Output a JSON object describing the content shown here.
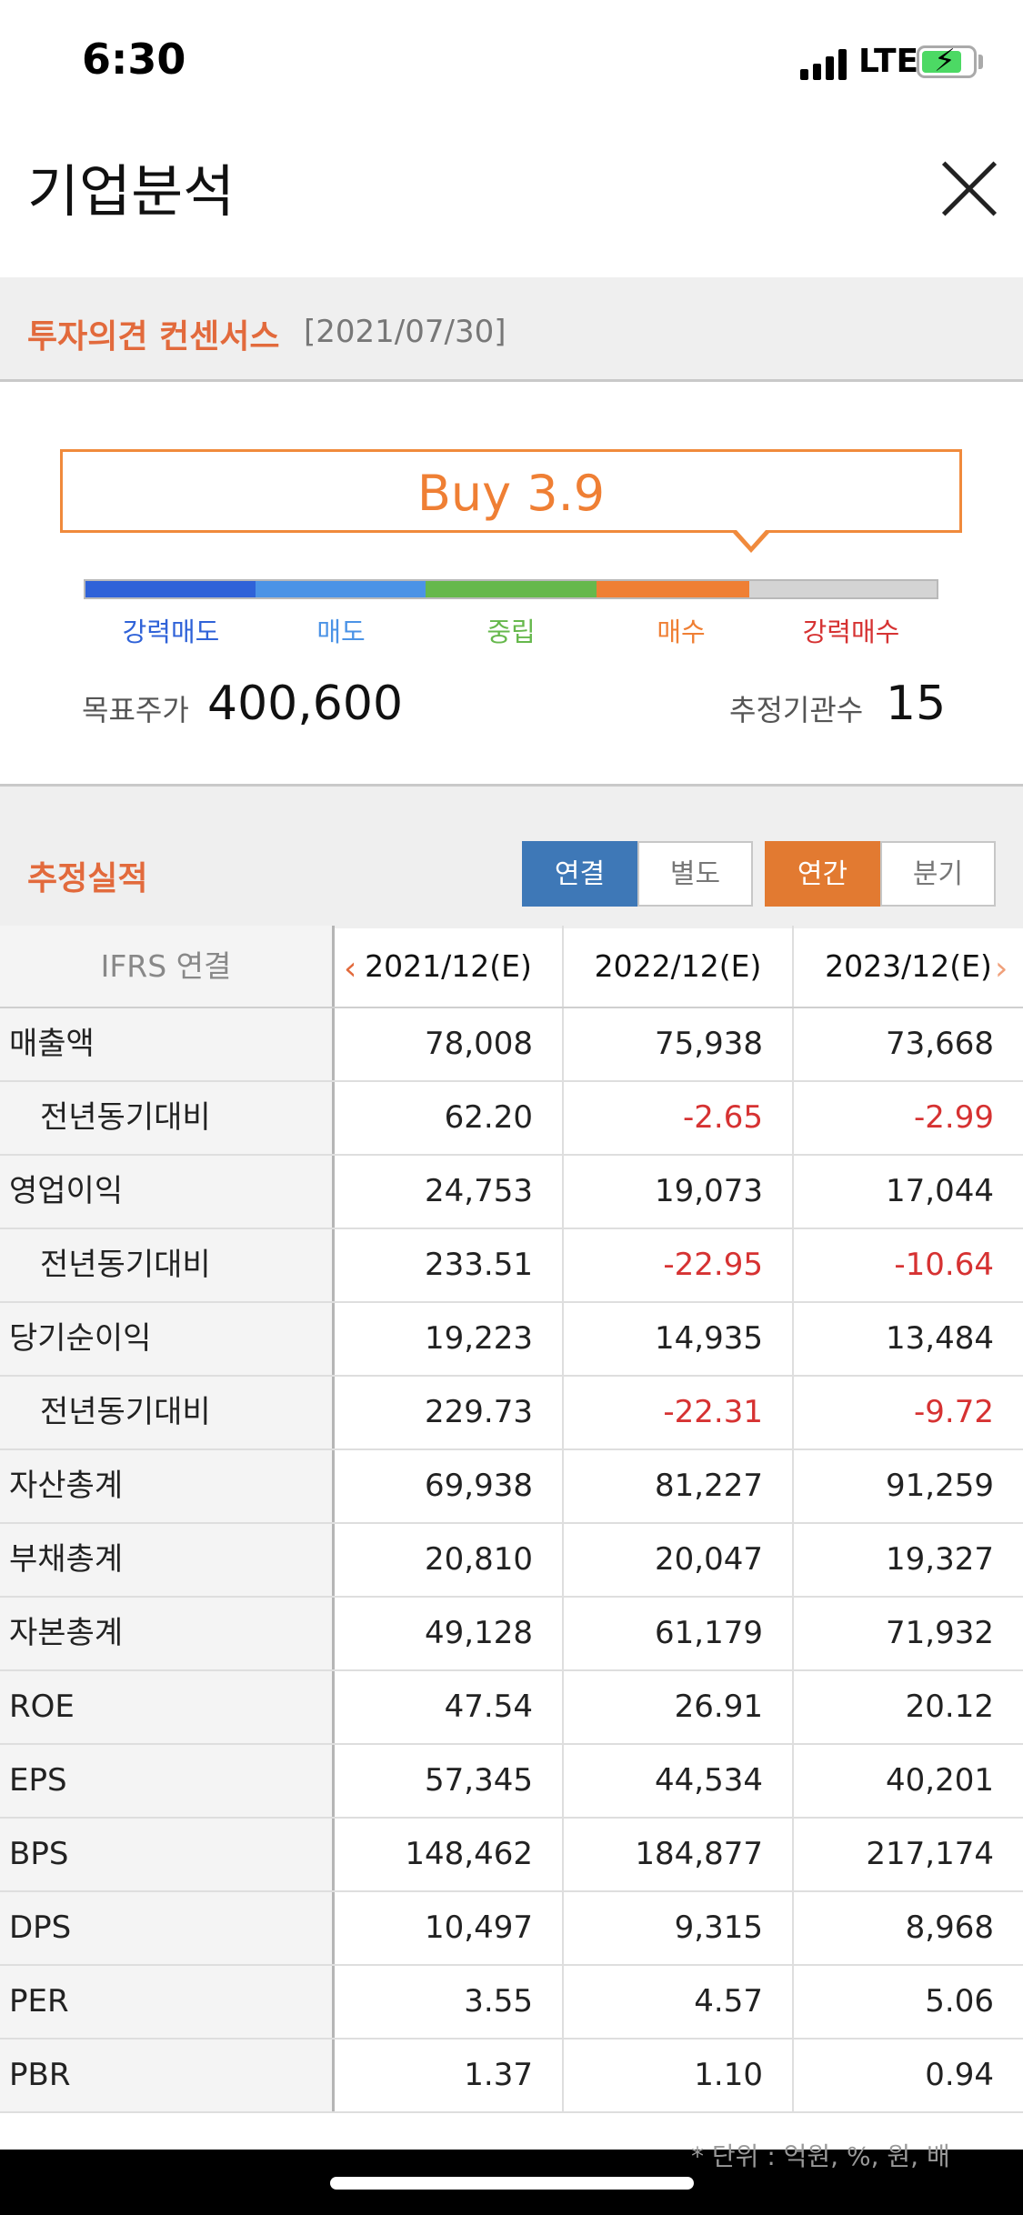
{
  "status_bar": {
    "time": "6:30",
    "network": "LTE"
  },
  "header": {
    "title": "기업분석"
  },
  "consensus": {
    "section_title": "투자의견 컨센서스",
    "date": "[2021/07/30]",
    "rating_text": "Buy 3.9",
    "rating_value": 3.9,
    "scale_labels": [
      "강력매도",
      "매도",
      "중립",
      "매수",
      "강력매수"
    ],
    "scale_colors": [
      "#2f62d8",
      "#4b93e6",
      "#66b84c",
      "#ef7f34",
      "#d4d4d4"
    ],
    "target_price_label": "목표주가",
    "target_price": "400,600",
    "institutions_label": "추정기관수",
    "institutions": "15"
  },
  "estimates": {
    "section_title": "추정실적",
    "toggle_basis": [
      "연결",
      "별도"
    ],
    "toggle_period": [
      "연간",
      "분기"
    ],
    "table": {
      "corner": "IFRS 연결",
      "columns": [
        "2021/12(E)",
        "2022/12(E)",
        "2023/12(E)"
      ],
      "rows": [
        {
          "label": "매출액",
          "values": [
            "78,008",
            "75,938",
            "73,668"
          ]
        },
        {
          "label": "전년동기대비",
          "values": [
            "62.20",
            "-2.65",
            "-2.99"
          ]
        },
        {
          "label": "영업이익",
          "values": [
            "24,753",
            "19,073",
            "17,044"
          ]
        },
        {
          "label": "전년동기대비",
          "values": [
            "233.51",
            "-22.95",
            "-10.64"
          ]
        },
        {
          "label": "당기순이익",
          "values": [
            "19,223",
            "14,935",
            "13,484"
          ]
        },
        {
          "label": "전년동기대비",
          "values": [
            "229.73",
            "-22.31",
            "-9.72"
          ]
        },
        {
          "label": "자산총계",
          "values": [
            "69,938",
            "81,227",
            "91,259"
          ]
        },
        {
          "label": "부채총계",
          "values": [
            "20,810",
            "20,047",
            "19,327"
          ]
        },
        {
          "label": "자본총계",
          "values": [
            "49,128",
            "61,179",
            "71,932"
          ]
        },
        {
          "label": "ROE",
          "values": [
            "47.54",
            "26.91",
            "20.12"
          ]
        },
        {
          "label": "EPS",
          "values": [
            "57,345",
            "44,534",
            "40,201"
          ]
        },
        {
          "label": "BPS",
          "values": [
            "148,462",
            "184,877",
            "217,174"
          ]
        },
        {
          "label": "DPS",
          "values": [
            "10,497",
            "9,315",
            "8,968"
          ]
        },
        {
          "label": "PER",
          "values": [
            "3.55",
            "4.57",
            "5.06"
          ]
        },
        {
          "label": "PBR",
          "values": [
            "1.37",
            "1.10",
            "0.94"
          ]
        }
      ]
    },
    "footnote": "* 단위 : 억원, %, 원, 배"
  }
}
